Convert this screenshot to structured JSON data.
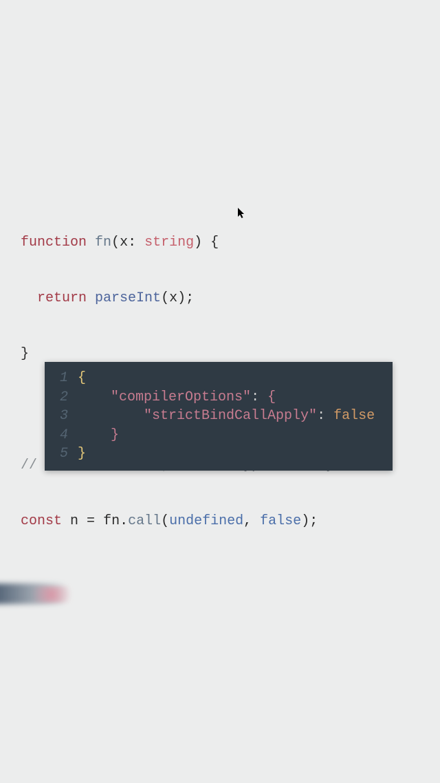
{
  "code_light": {
    "line1": {
      "kw_function": "function",
      "space1": " ",
      "fn_name": "fn",
      "open_paren": "(",
      "param": "x",
      "colon": ": ",
      "type": "string",
      "close_paren": ")",
      "space2": " ",
      "open_brace": "{"
    },
    "line2": {
      "indent": "  ",
      "kw_return": "return",
      "space1": " ",
      "call": "parseInt",
      "open_paren": "(",
      "arg": "x",
      "close_paren": ")",
      "semi": ";"
    },
    "line3": {
      "close_brace": "}"
    },
    "line4_blank": "",
    "line5": {
      "comment": "// Note: No error; return type is 'any'"
    },
    "line6": {
      "kw_const": "const",
      "space1": " ",
      "var": "n",
      "eq": " = ",
      "obj": "fn",
      "dot": ".",
      "method": "call",
      "open_paren": "(",
      "arg1": "undefined",
      "comma": ", ",
      "arg2": "false",
      "close_paren": ")",
      "semi": ";"
    }
  },
  "code_dark": {
    "gutter": [
      "1",
      "2",
      "3",
      "4",
      "5"
    ],
    "lines": {
      "l1": {
        "brace": "{"
      },
      "l2": {
        "indent": "    ",
        "key": "\"compilerOptions\"",
        "colon": ": ",
        "brace": "{"
      },
      "l3": {
        "indent": "        ",
        "key": "\"strictBindCallApply\"",
        "colon": ": ",
        "val": "false"
      },
      "l4": {
        "indent": "    ",
        "brace": "}"
      },
      "l5": {
        "brace": "}"
      }
    }
  },
  "colors": {
    "light_bg": "#eceded",
    "dark_bg": "#2f3a44",
    "keyword": "#a23a47",
    "type": "#c55f6b",
    "identifier": "#65778a",
    "call": "#4c649b",
    "comment": "#8a8f93",
    "literal": "#4a6ea9",
    "json_key": "#c77c90",
    "json_bool": "#d19a66",
    "brace_outer": "#e6c97a",
    "gutter": "#546472"
  }
}
